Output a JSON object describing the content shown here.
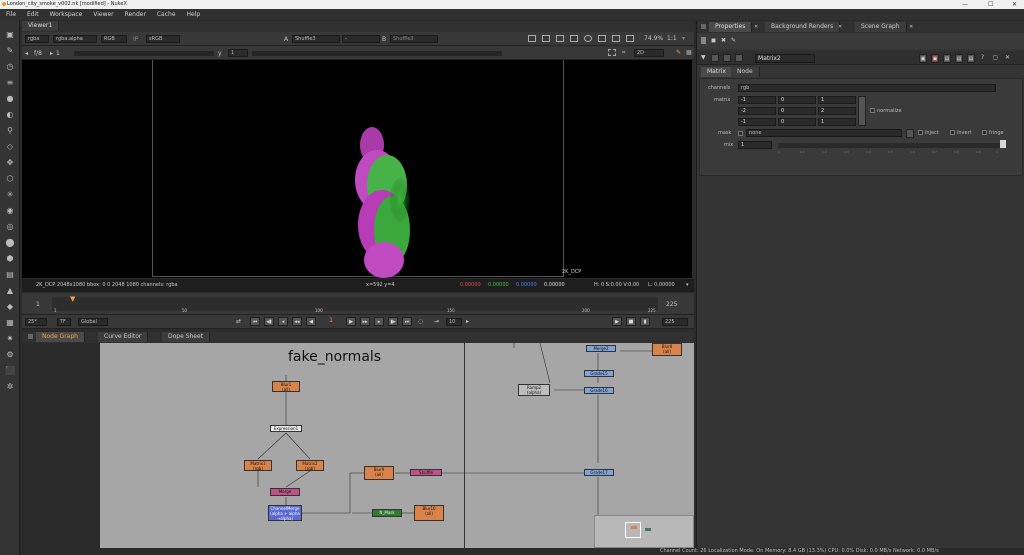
{
  "window": {
    "title": "London_city_smoke_v002.nk [modified] - NukeX",
    "minimize": "—",
    "maximize": "☐",
    "close": "✕"
  },
  "menu": [
    "File",
    "Edit",
    "Workspace",
    "Viewer",
    "Render",
    "Cache",
    "Help"
  ],
  "viewer_panel": {
    "tab": "Viewer1",
    "channels": "rgba",
    "alpha": "rgba.alpha",
    "colorspace": "RGB",
    "ip": "IP",
    "lut": "sRGB",
    "a_label": "A",
    "a_input": "Shuffle3",
    "dash": "-",
    "b_label": "B",
    "b_input": "Shuffle3",
    "zoom": "74.9%",
    "ratio": "1:1",
    "mode": "2D",
    "fstop": "f/8",
    "frame": "1",
    "y_label": "y",
    "y_value": "1",
    "format_label": "2K_DCP",
    "info_left": "2K_DCP 2048x1080  bbox: 0 0 2048 1080 channels: rgba",
    "coords": "x=592 y=4",
    "r": "0.00000",
    "g": "0.00000",
    "b": "0.00000",
    "a": "0.00000",
    "hsv": "H:   0 S:0.00 V:0.00",
    "lum": "L: 0.00000"
  },
  "timeline": {
    "start": "1",
    "end": "225",
    "ticks": [
      "1",
      "50",
      "100",
      "150",
      "200",
      "225"
    ],
    "fps": "25*",
    "tf": "TF",
    "scope": "Global",
    "current": "1",
    "step": "10",
    "end_field": "225"
  },
  "graph_tabs": [
    "Node Graph",
    "Curve Editor",
    "Dope Sheet"
  ],
  "graph": {
    "backdrop_label": "fake_normals",
    "nodes": [
      {
        "id": "blur1",
        "label": "Blur1\n(all)"
      },
      {
        "id": "expression1",
        "label": "Expression1"
      },
      {
        "id": "matrix1",
        "label": "Matrix1\n(rgb)"
      },
      {
        "id": "matrix2",
        "label": "Matrix2\n(rgb)"
      },
      {
        "id": "merge",
        "label": "Merge"
      },
      {
        "id": "channelmerge",
        "label": "ChannelMerge\n(alpha + alpha\n→alpha)"
      },
      {
        "id": "blur9",
        "label": "Blur9\n(all)"
      },
      {
        "id": "shuffle",
        "label": "Shuffle"
      },
      {
        "id": "nmask",
        "label": "N_Mask"
      },
      {
        "id": "blur10",
        "label": "Blur10\n(all)"
      },
      {
        "id": "ramp2",
        "label": "Ramp2\n(alpha)"
      },
      {
        "id": "grade15",
        "label": "Grade15"
      },
      {
        "id": "grade16",
        "label": "Grade16"
      },
      {
        "id": "grade17",
        "label": "Grade17"
      },
      {
        "id": "merge2",
        "label": "Merge2"
      },
      {
        "id": "blur8",
        "label": "Blur8\n(all)"
      }
    ]
  },
  "status": "Channel Count: 26  Localization Mode: On  Memory: 8.4 GB (13.3%)  CPU: 0.0%  Disk: 0.0 MB/s  Network: 0.0 MB/s",
  "properties": {
    "tabs": [
      "Properties",
      "Background Renders",
      "Scene Graph"
    ],
    "node_name": "Matrix2",
    "sub_tabs": [
      "Matrix",
      "Node"
    ],
    "channels_label": "channels",
    "channels_value": "rgb",
    "matrix_label": "matrix",
    "matrix": [
      [
        "-1",
        "0",
        "1"
      ],
      [
        "-2",
        "0",
        "2"
      ],
      [
        "-1",
        "0",
        "1"
      ]
    ],
    "normalize_label": "normalize",
    "mask_label": "mask",
    "mask_value": "none",
    "inject_label": "inject",
    "invert_label": "invert",
    "fringe_label": "fringe",
    "mix_label": "mix",
    "mix_value": "1",
    "mix_ticks": [
      "0",
      "0.1",
      "0.2",
      "0.3",
      "0.4",
      "0.5",
      "0.6",
      "0.7",
      "0.8",
      "0.9",
      "1"
    ]
  },
  "colors": {
    "accent": "#f0a040",
    "viewer_bg": "#000000",
    "graph_bg": "#a6a6a6"
  }
}
